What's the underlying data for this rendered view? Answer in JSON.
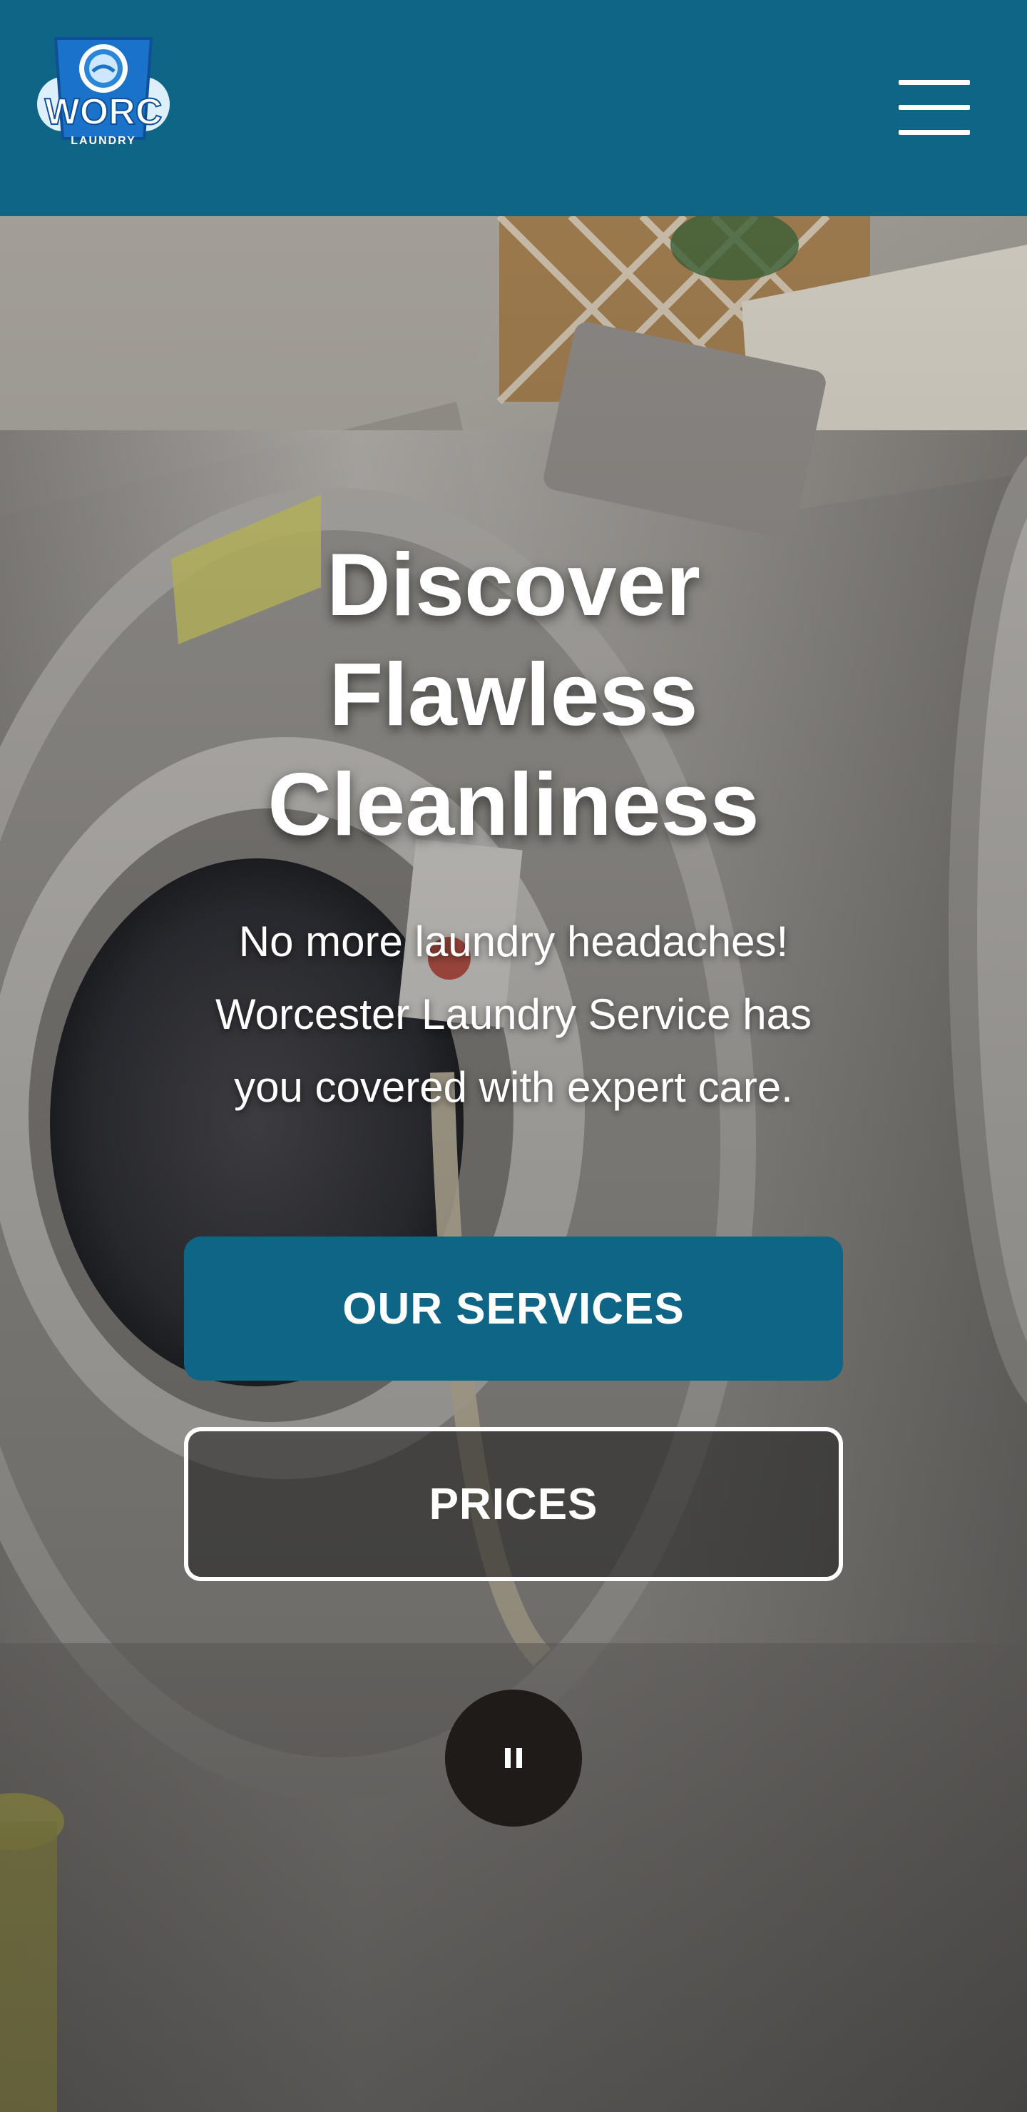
{
  "header": {
    "logo": {
      "wordmark": "WORC",
      "tagline": "LAUNDRY"
    },
    "menu_icon": "hamburger-menu-icon"
  },
  "hero": {
    "headline_lines": [
      "Discover",
      "Flawless",
      "Cleanliness"
    ],
    "subtext_lines": [
      "No more laundry headaches!",
      "Worcester Laundry Service has",
      "you covered with expert care."
    ],
    "primary_button": "OUR SERVICES",
    "secondary_button": "PRICES",
    "video_control_icon": "pause-icon"
  },
  "colors": {
    "brand_teal": "#0e6585",
    "text": "#ffffff",
    "pause_button": "#1e1b19",
    "logo_blue": "#1a73c9"
  }
}
